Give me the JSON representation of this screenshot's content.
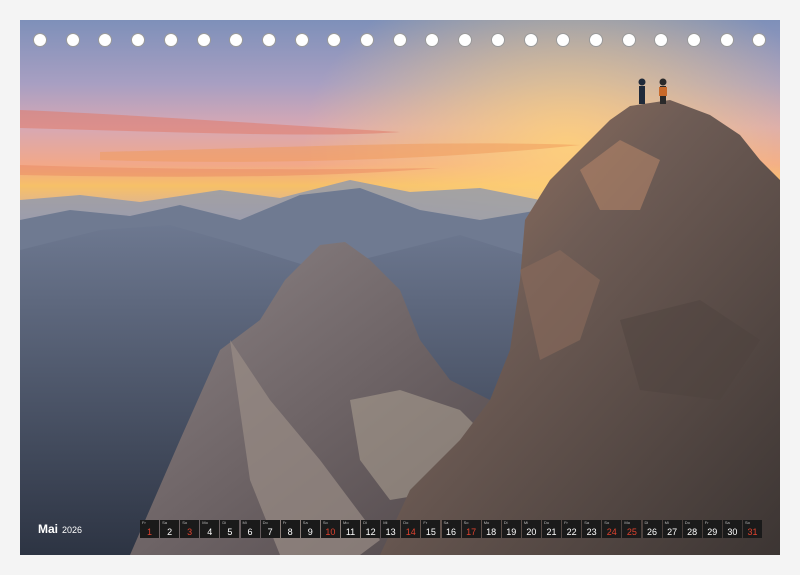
{
  "calendar": {
    "month_label": "Mai",
    "year_label": "2026",
    "ring_count": 23,
    "days": [
      {
        "wd": "Fr",
        "n": "1",
        "red": true
      },
      {
        "wd": "Sa",
        "n": "2",
        "red": false
      },
      {
        "wd": "So",
        "n": "3",
        "red": true
      },
      {
        "wd": "Mo",
        "n": "4",
        "red": false
      },
      {
        "wd": "Di",
        "n": "5",
        "red": false
      },
      {
        "wd": "Mi",
        "n": "6",
        "red": false
      },
      {
        "wd": "Do",
        "n": "7",
        "red": false
      },
      {
        "wd": "Fr",
        "n": "8",
        "red": false
      },
      {
        "wd": "Sa",
        "n": "9",
        "red": false
      },
      {
        "wd": "So",
        "n": "10",
        "red": true
      },
      {
        "wd": "Mo",
        "n": "11",
        "red": false
      },
      {
        "wd": "Di",
        "n": "12",
        "red": false
      },
      {
        "wd": "Mi",
        "n": "13",
        "red": false
      },
      {
        "wd": "Do",
        "n": "14",
        "red": true
      },
      {
        "wd": "Fr",
        "n": "15",
        "red": false
      },
      {
        "wd": "Sa",
        "n": "16",
        "red": false
      },
      {
        "wd": "So",
        "n": "17",
        "red": true
      },
      {
        "wd": "Mo",
        "n": "18",
        "red": false
      },
      {
        "wd": "Di",
        "n": "19",
        "red": false
      },
      {
        "wd": "Mi",
        "n": "20",
        "red": false
      },
      {
        "wd": "Do",
        "n": "21",
        "red": false
      },
      {
        "wd": "Fr",
        "n": "22",
        "red": false
      },
      {
        "wd": "Sa",
        "n": "23",
        "red": false
      },
      {
        "wd": "So",
        "n": "24",
        "red": true
      },
      {
        "wd": "Mo",
        "n": "25",
        "red": true
      },
      {
        "wd": "Di",
        "n": "26",
        "red": false
      },
      {
        "wd": "Mi",
        "n": "27",
        "red": false
      },
      {
        "wd": "Do",
        "n": "28",
        "red": false
      },
      {
        "wd": "Fr",
        "n": "29",
        "red": false
      },
      {
        "wd": "Sa",
        "n": "30",
        "red": false
      },
      {
        "wd": "So",
        "n": "31",
        "red": true
      }
    ]
  },
  "colors": {
    "sky_top": "#7f8fb8",
    "sky_glow": "#f5b35a",
    "rock": "#6f615a",
    "holiday_red": "#e0432f"
  }
}
